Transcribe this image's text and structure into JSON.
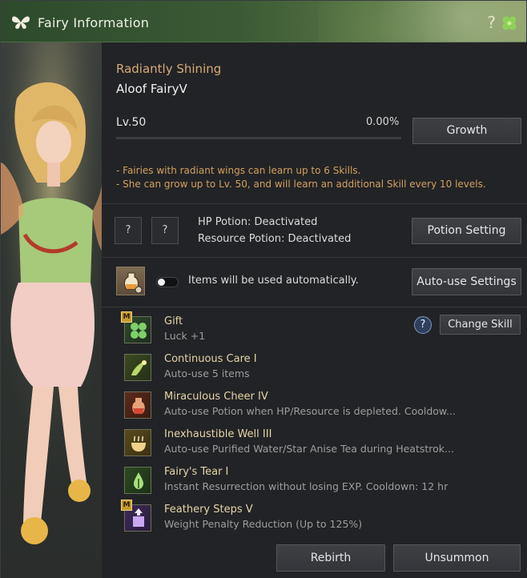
{
  "window": {
    "title": "Fairy Information",
    "help_glyph": "?"
  },
  "fairy": {
    "status": "Radiantly Shining",
    "name": "Aloof FairyV",
    "level_label": "Lv.50",
    "progress_label": "0.00%",
    "progress": 0.0
  },
  "buttons": {
    "growth": "Growth",
    "potion_setting": "Potion Setting",
    "auto_use_settings": "Auto-use Settings",
    "change_skill": "Change Skill",
    "rebirth": "Rebirth",
    "unsummon": "Unsummon"
  },
  "description": [
    "- Fairies with radiant wings can learn up to 6 Skills.",
    "- She can grow up to Lv. 50, and will learn an additional Skill every 10 levels."
  ],
  "potion": {
    "slot1": "?",
    "slot2": "?",
    "hp": "HP Potion: Deactivated",
    "resource": "Resource Potion: Deactivated"
  },
  "auto_use": {
    "text": "Items will be used automatically.",
    "enabled": false
  },
  "skill_help_glyph": "?",
  "skills": [
    {
      "name": "Gift",
      "desc": "Luck +1",
      "badge": "M",
      "icon": "clover-icon"
    },
    {
      "name": "Continuous Care I",
      "desc": "Auto-use 5 items",
      "badge": "",
      "icon": "fairy-hand-icon"
    },
    {
      "name": "Miraculous Cheer IV",
      "desc": "Auto-use Potion when HP/Resource is depleted. Cooldow...",
      "badge": "",
      "icon": "potion-flask-icon"
    },
    {
      "name": "Inexhaustible Well III",
      "desc": "Auto-use Purified Water/Star Anise Tea during Heatstrok...",
      "badge": "",
      "icon": "tea-cup-icon"
    },
    {
      "name": "Fairy's Tear I",
      "desc": "Instant Resurrection without losing EXP. Cooldown: 12 hr",
      "badge": "",
      "icon": "tear-sprout-icon"
    },
    {
      "name": "Feathery Steps V",
      "desc": "Weight Penalty Reduction (Up to 125%)",
      "badge": "M",
      "icon": "weight-arrow-icon"
    }
  ],
  "colors": {
    "accent": "#d7aa76",
    "title_bar": "#3b5a34",
    "panel": "#222326",
    "skill_name": "#e6d4a8"
  }
}
